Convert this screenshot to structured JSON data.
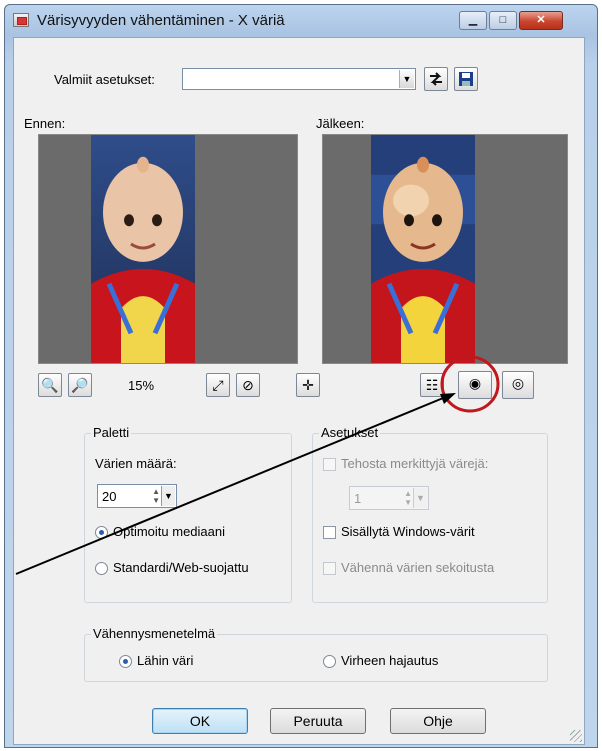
{
  "window": {
    "title": "Värisyvyyden vähentäminen - X väriä"
  },
  "presets": {
    "label": "Valmiit asetukset:",
    "value": ""
  },
  "before_label": "Ennen:",
  "after_label": "Jälkeen:",
  "zoom": {
    "value": "15%"
  },
  "palette": {
    "title": "Paletti",
    "count_label": "Värien määrä:",
    "count_value": "20",
    "options": [
      {
        "label": "Optimoitu mediaani",
        "selected": true
      },
      {
        "label": "Standardi/Web-suojattu",
        "selected": false
      }
    ]
  },
  "settings": {
    "title": "Asetukset",
    "boost_label": "Tehosta merkittyjä värejä:",
    "boost_value": "1",
    "include_windows_label": "Sisällytä Windows-värit",
    "reduce_mixing_label": "Vähennä värien sekoitusta"
  },
  "method": {
    "title": "Vähennysmenetelmä",
    "options": [
      {
        "label": "Lähin väri",
        "selected": true
      },
      {
        "label": "Virheen hajautus",
        "selected": false
      }
    ]
  },
  "buttons": {
    "ok": "OK",
    "cancel": "Peruuta",
    "help": "Ohje"
  },
  "icons": {
    "app": "image-icon",
    "minimize": "minimize-icon",
    "maximize": "maximize-icon",
    "close": "close-icon",
    "load_preset": "load-preset-icon",
    "save_preset": "save-icon",
    "zoom_out": "zoom-out-icon",
    "zoom_in": "zoom-in-icon",
    "fit": "fit-window-icon",
    "reset": "reset-icon",
    "pan": "pan-icon",
    "toggle_view": "layout-toggle-icon",
    "proof": "proof-eye-icon",
    "auto_proof": "auto-proof-eye-icon"
  },
  "colors": {
    "annotation": "#c0181c",
    "accent": "#2c5cb4"
  }
}
